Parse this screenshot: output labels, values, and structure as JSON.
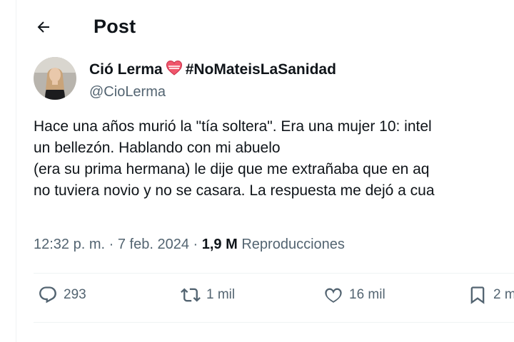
{
  "header": {
    "title": "Post"
  },
  "author": {
    "display_name": "Ció Lerma",
    "hashtag": "#NoMateisLaSanidad",
    "handle": "@CioLerma"
  },
  "tweet": {
    "lines": [
      "Hace una años murió la \"tía soltera\". Era una mujer 10: intel",
      "un bellezón. Hablando con mi abuelo",
      "(era su prima hermana) le dije que me extrañaba que en aq",
      "no tuviera novio y no se casara. La respuesta me dejó a cua"
    ]
  },
  "meta": {
    "time": "12:32 p. m.",
    "separator": "·",
    "date": "7 feb. 2024",
    "views_count": "1,9 M",
    "views_label": "Reproducciones"
  },
  "actions": {
    "replies": "293",
    "reposts": "1 mil",
    "likes": "16 mil",
    "bookmarks": "2 m"
  },
  "colors": {
    "text": "#0f1419",
    "secondary": "#536471",
    "divider": "#eff3f4",
    "heart": "#f0566c"
  }
}
